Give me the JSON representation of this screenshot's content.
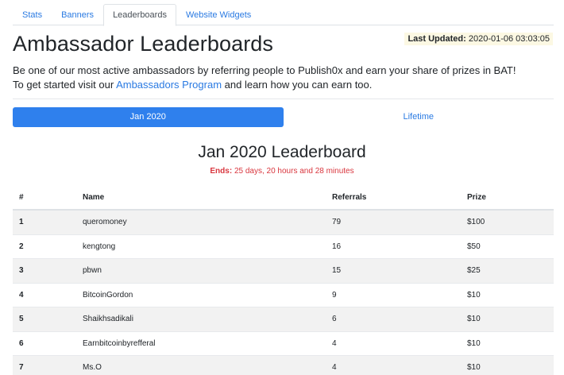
{
  "tabs": [
    {
      "label": "Stats",
      "active": false
    },
    {
      "label": "Banners",
      "active": false
    },
    {
      "label": "Leaderboards",
      "active": true
    },
    {
      "label": "Website Widgets",
      "active": false
    }
  ],
  "header": {
    "title": "Ambassador Leaderboards",
    "last_updated_label": "Last Updated:",
    "last_updated_value": "2020-01-06 03:03:05"
  },
  "intro": {
    "line1": "Be one of our most active ambassadors by referring people to Publish0x and earn your share of prizes in BAT!",
    "line2_prefix": "To get started visit our ",
    "line2_link": "Ambassadors Program",
    "line2_suffix": " and learn how you can earn too."
  },
  "period_tabs": [
    {
      "label": "Jan 2020",
      "active": true
    },
    {
      "label": "Lifetime",
      "active": false
    }
  ],
  "board": {
    "title": "Jan 2020 Leaderboard",
    "ends_label": "Ends:",
    "ends_value": "25 days, 20 hours and 28 minutes"
  },
  "table": {
    "columns": [
      "#",
      "Name",
      "Referrals",
      "Prize"
    ],
    "rows": [
      {
        "rank": "1",
        "name": "queromoney",
        "referrals": "79",
        "prize": "$100"
      },
      {
        "rank": "2",
        "name": "kengtong",
        "referrals": "16",
        "prize": "$50"
      },
      {
        "rank": "3",
        "name": "pbwn",
        "referrals": "15",
        "prize": "$25"
      },
      {
        "rank": "4",
        "name": "BitcoinGordon",
        "referrals": "9",
        "prize": "$10"
      },
      {
        "rank": "5",
        "name": "Shaikhsadikali",
        "referrals": "6",
        "prize": "$10"
      },
      {
        "rank": "6",
        "name": "Earnbitcoinbyrefferal",
        "referrals": "4",
        "prize": "$10"
      },
      {
        "rank": "7",
        "name": "Ms.O",
        "referrals": "4",
        "prize": "$10"
      }
    ]
  },
  "colors": {
    "accent": "#2f80ed",
    "link": "#2a7ae2",
    "ends": "#d9363e",
    "highlight": "#fcf8e3"
  }
}
